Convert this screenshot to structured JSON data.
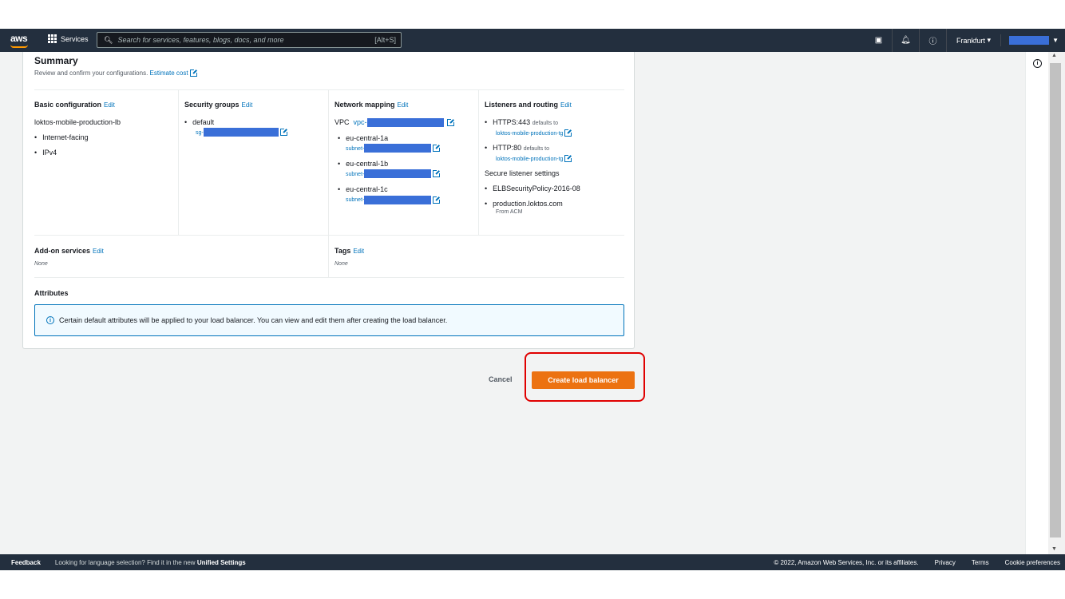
{
  "topbar": {
    "logo": "aws",
    "services": "Services",
    "search_placeholder": "Search for services, features, blogs, docs, and more",
    "search_shortcut": "[Alt+S]",
    "region": "Frankfurt"
  },
  "summary": {
    "title": "Summary",
    "subtitle": "Review and confirm your configurations.",
    "estimate_cost": "Estimate cost"
  },
  "basic": {
    "title": "Basic configuration",
    "edit": "Edit",
    "name": "loktos-mobile-production-lb",
    "items": [
      "Internet-facing",
      "IPv4"
    ]
  },
  "security": {
    "title": "Security groups",
    "edit": "Edit",
    "group": "default",
    "sg_prefix": "sg-"
  },
  "network": {
    "title": "Network mapping",
    "edit": "Edit",
    "vpc_label": "VPC",
    "vpc_prefix": "vpc-",
    "zones": [
      "eu-central-1a",
      "eu-central-1b",
      "eu-central-1c"
    ],
    "subnet_prefix": "subnet-"
  },
  "listeners": {
    "title": "Listeners and routing",
    "edit": "Edit",
    "l1": "HTTPS:443",
    "l2": "HTTP:80",
    "defaults_to": "defaults to",
    "tg": "loktos-mobile-production-tg",
    "secure_title": "Secure listener settings",
    "policy": "ELBSecurityPolicy-2016-08",
    "cert": "production.loktos.com",
    "cert_src": "From ACM"
  },
  "addons": {
    "title": "Add-on services",
    "edit": "Edit",
    "value": "None"
  },
  "tags": {
    "title": "Tags",
    "edit": "Edit",
    "value": "None"
  },
  "attributes": {
    "title": "Attributes",
    "info": "Certain default attributes will be applied to your load balancer. You can view and edit them after creating the load balancer."
  },
  "actions": {
    "cancel": "Cancel",
    "create": "Create load balancer"
  },
  "footer": {
    "feedback": "Feedback",
    "lang_text": "Looking for language selection? Find it in the new",
    "unified": "Unified Settings",
    "copyright": "© 2022, Amazon Web Services, Inc. or its affiliates.",
    "privacy": "Privacy",
    "terms": "Terms",
    "cookie": "Cookie preferences"
  },
  "colors": {
    "nav": "#232f3e",
    "accent": "#ec7211",
    "link": "#0073bb",
    "highlight": "#e00000"
  }
}
